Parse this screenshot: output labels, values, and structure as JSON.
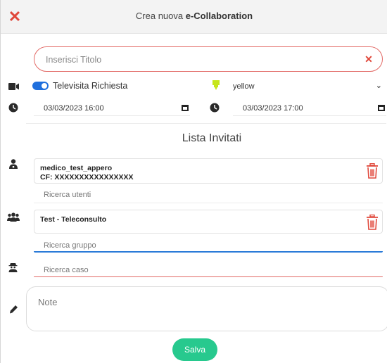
{
  "header": {
    "title_prefix": "Crea nuova ",
    "title_bold": "e-Collaboration"
  },
  "form": {
    "title_placeholder": "Inserisci Titolo",
    "televisit_label": "Televisita Richiesta",
    "televisit_enabled": true,
    "color_value": "yellow",
    "start_datetime": "03/03/2023 16:00",
    "end_datetime": "03/03/2023 17:00",
    "notes_placeholder": "Note",
    "save_label": "Salva"
  },
  "invitati": {
    "section_title": "Lista Invitati",
    "user": {
      "name": "medico_test_appero",
      "cf": "CF: XXXXXXXXXXXXXXXX"
    },
    "user_search_placeholder": "Ricerca utenti",
    "group": {
      "name": "Test - Teleconsulto"
    },
    "group_search_placeholder": "Ricerca gruppo",
    "case_search_placeholder": "Ricerca caso"
  },
  "colors": {
    "accent_red": "#e0473a",
    "toggle_blue": "#1f6fdd",
    "save_green": "#27c98e",
    "marker_yellow": "#c6e61c"
  },
  "icons": {
    "close": "close-icon",
    "clear": "clear-icon",
    "video": "video-camera-icon",
    "marker": "marker-icon",
    "clock_start": "clock-icon",
    "clock_end": "clock-icon",
    "user": "user-doctor-icon",
    "group": "users-group-icon",
    "case": "user-secret-icon",
    "notes": "pencil-icon",
    "trash": "trash-icon"
  }
}
